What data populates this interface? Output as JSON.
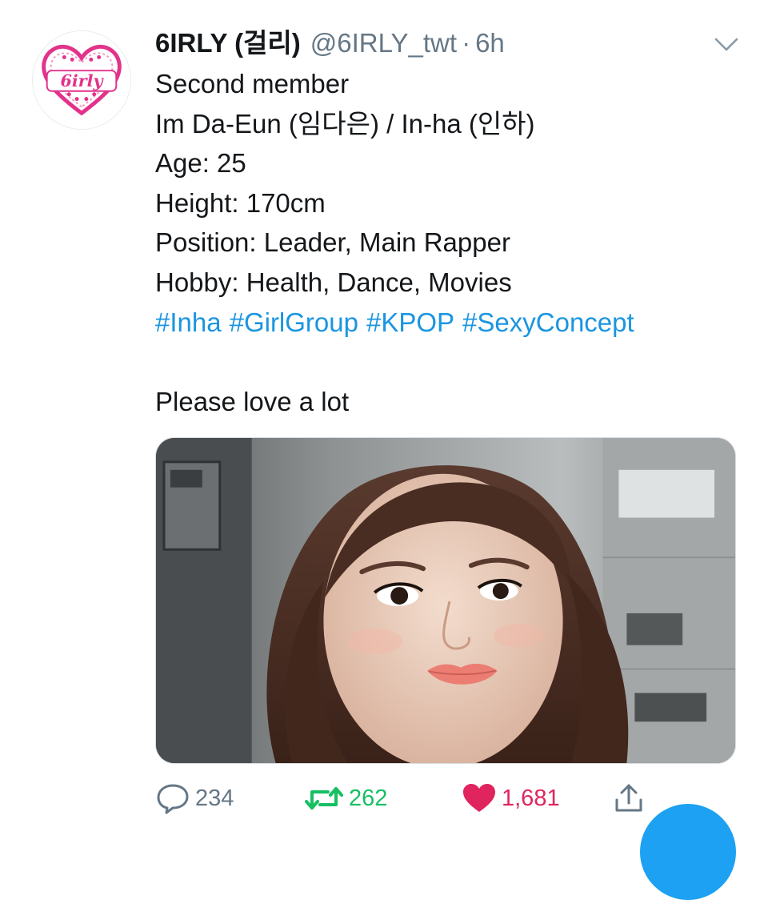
{
  "tweet": {
    "display_name": "6IRLY (걸리)",
    "handle": "@6IRLY_twt",
    "separator": "·",
    "time": "6h",
    "avatar_logo_text": "6irly",
    "lines": [
      "Second member",
      "Im Da-Eun (임다은) / In-ha (인하)",
      "Age: 25",
      "Height: 170cm",
      "Position: Leader, Main Rapper",
      "Hobby: Health, Dance, Movies"
    ],
    "hashtags": [
      "#Inha",
      "#GirlGroup",
      "#KPOP",
      "#SexyConcept"
    ],
    "closing": "Please love a lot"
  },
  "actions": {
    "reply_count": "234",
    "retweet_count": "262",
    "like_count": "1,681",
    "liked": true
  },
  "icons": {
    "reply": "reply-icon",
    "retweet": "retweet-icon",
    "like": "heart-icon",
    "share": "share-icon",
    "menu": "chevron-down-icon"
  },
  "colors": {
    "text": "#14171a",
    "muted": "#657786",
    "link": "#1b95e0",
    "retweet": "#17bf63",
    "like": "#e0245e",
    "fab": "#1da1f2",
    "logo_pink": "#e2338b"
  }
}
